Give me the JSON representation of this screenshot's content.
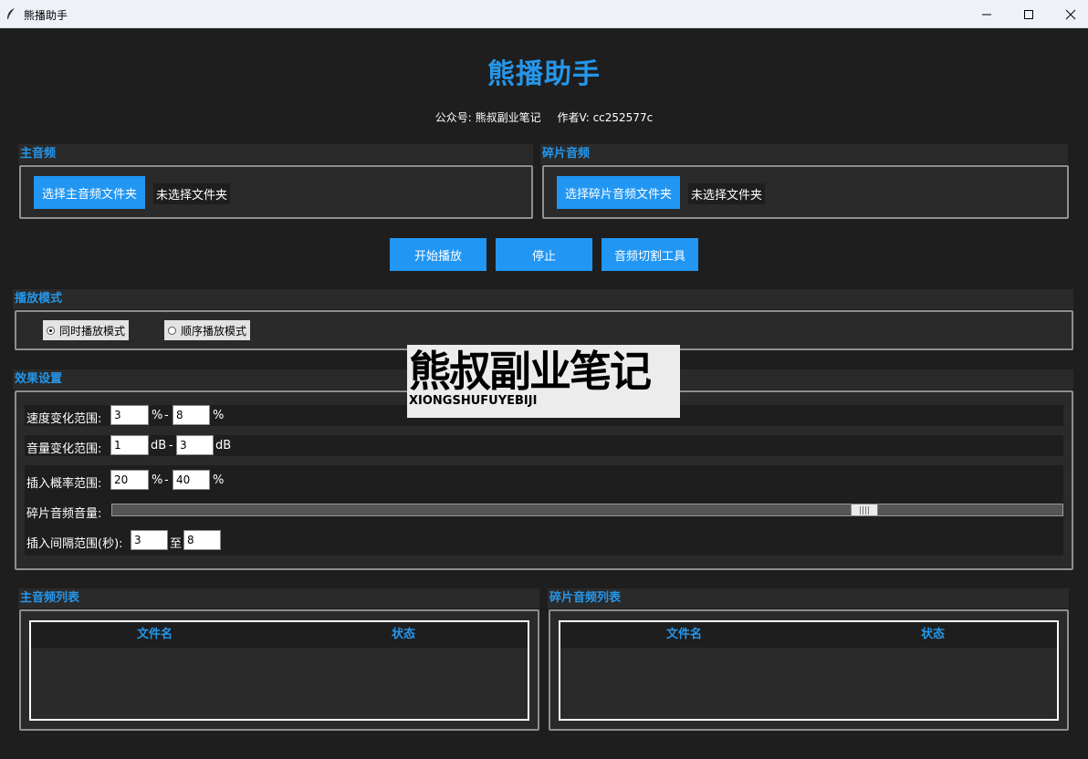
{
  "window": {
    "title": "熊播助手"
  },
  "header": {
    "title": "熊播助手",
    "subtitle_left": "公众号: 熊叔副业笔记",
    "subtitle_right": "作者V: cc252577c"
  },
  "main_audio": {
    "section_title": "主音频",
    "button_label": "选择主音频文件夹",
    "status": "未选择文件夹"
  },
  "fragment_audio": {
    "section_title": "碎片音频",
    "button_label": "选择碎片音频文件夹",
    "status": "未选择文件夹"
  },
  "controls": {
    "start_label": "开始播放",
    "stop_label": "停止",
    "cut_tool_label": "音频切割工具"
  },
  "play_mode": {
    "section_title": "播放模式",
    "options": [
      {
        "label": "同时播放模式",
        "selected": true
      },
      {
        "label": "顺序播放模式",
        "selected": false
      }
    ]
  },
  "effects": {
    "section_title": "效果设置",
    "speed": {
      "label": "速度变化范围:",
      "min": "3",
      "max": "8",
      "unit": "%"
    },
    "volume": {
      "label": "音量变化范围:",
      "min": "1",
      "max": "3",
      "unit": "dB"
    },
    "probability": {
      "label": "插入概率范围:",
      "min": "20",
      "max": "40",
      "unit": "%"
    },
    "fragment_volume": {
      "label": "碎片音频音量:",
      "value_fraction": 0.8
    },
    "interval": {
      "label": "插入间隔范围(秒):",
      "min": "3",
      "max": "8",
      "separator": "至"
    },
    "dash": "-"
  },
  "main_list": {
    "section_title": "主音频列表",
    "columns": [
      "文件名",
      "状态"
    ]
  },
  "fragment_list": {
    "section_title": "碎片音频列表",
    "columns": [
      "文件名",
      "状态"
    ]
  },
  "watermark": {
    "big": "熊叔副业笔记",
    "small": "XIONGSHUFUYEBIJI"
  }
}
